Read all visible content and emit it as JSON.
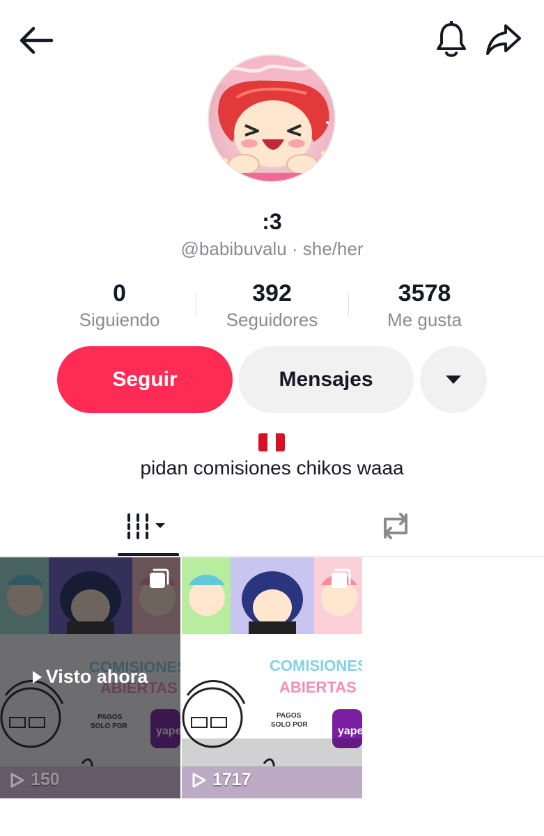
{
  "profile": {
    "display_name": ":3",
    "handle_line": "@babibuvalu · she/her",
    "bio_flag": "flag-peru",
    "bio_text": "pidan comisiones chikos waaa"
  },
  "stats": {
    "following": {
      "value": "0",
      "label": "Siguiendo"
    },
    "followers": {
      "value": "392",
      "label": "Seguidores"
    },
    "likes": {
      "value": "3578",
      "label": "Me gusta"
    }
  },
  "actions": {
    "follow_label": "Seguir",
    "message_label": "Mensajes"
  },
  "icons": {
    "back": "back-arrow-icon",
    "bell": "bell-icon",
    "share": "share-icon",
    "more": "caret-down-icon",
    "videos_tab": "grid-icon",
    "reposts_tab": "repost-icon"
  },
  "colors": {
    "accent": "#fe2c55",
    "secondary_button": "#f1f1f2",
    "text_primary": "#161823",
    "text_secondary": "#8a8b91"
  },
  "videos": [
    {
      "watched_label": "Visto ahora",
      "views": "150",
      "tile_text": {
        "line1": "COMISIONES",
        "line2": "ABIERTAS",
        "pay1": "PAGOS",
        "pay2": "SOLO POR",
        "brand": "yape"
      }
    },
    {
      "views": "1717",
      "tile_text": {
        "line1": "COMISIONES",
        "line2": "ABIERTAS",
        "pay1": "PAGOS",
        "pay2": "SOLO POR",
        "brand": "yape"
      }
    }
  ]
}
